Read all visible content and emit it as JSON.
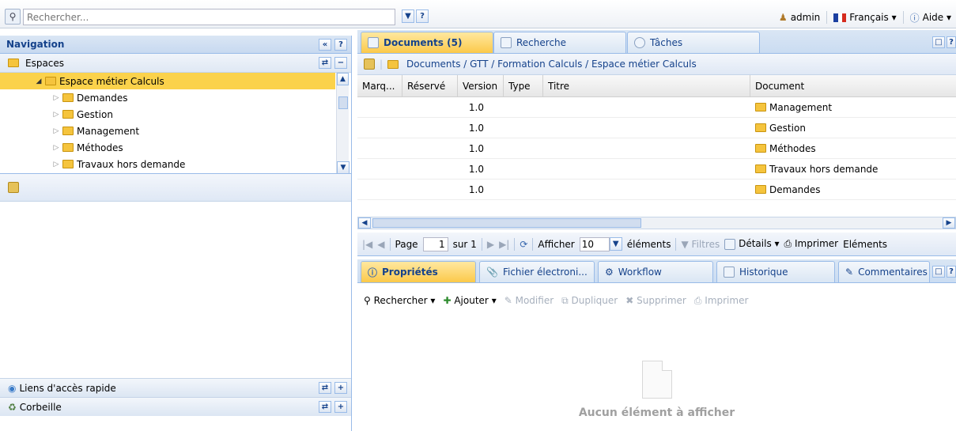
{
  "topbar": {
    "search_placeholder": "Rechercher...",
    "user": "admin",
    "language": "Français ▾",
    "help": "Aide ▾"
  },
  "navigation": {
    "title": "Navigation",
    "spaces_label": "Espaces",
    "tree": [
      {
        "label": "Espace métier Calculs",
        "selected": true,
        "level": 0
      },
      {
        "label": "Demandes",
        "level": 1
      },
      {
        "label": "Gestion",
        "level": 1
      },
      {
        "label": "Management",
        "level": 1
      },
      {
        "label": "Méthodes",
        "level": 1
      },
      {
        "label": "Travaux hors demande",
        "level": 1
      }
    ],
    "quick_links": "Liens d'accès rapide",
    "trash": "Corbeille"
  },
  "tabs": {
    "documents": "Documents (5)",
    "search": "Recherche",
    "tasks": "Tâches"
  },
  "breadcrumb": "Documents / GTT / Formation Calculs / Espace métier Calculs",
  "grid": {
    "columns": [
      "Marq...",
      "Réservé",
      "Version",
      "Type",
      "Titre",
      "Document"
    ],
    "rows": [
      {
        "version": "1.0",
        "document": "Management"
      },
      {
        "version": "1.0",
        "document": "Gestion"
      },
      {
        "version": "1.0",
        "document": "Méthodes"
      },
      {
        "version": "1.0",
        "document": "Travaux hors demande"
      },
      {
        "version": "1.0",
        "document": "Demandes"
      }
    ]
  },
  "pager": {
    "page_label": "Page",
    "page": "1",
    "of": "sur 1",
    "show_label": "Afficher",
    "page_size": "10",
    "items_label": "éléments",
    "filters": "Filtres",
    "details": "Détails ▾",
    "print": "Imprimer",
    "elements": "Eléments"
  },
  "detail_tabs": {
    "properties": "Propriétés",
    "file": "Fichier électroni...",
    "workflow": "Workflow",
    "history": "Historique",
    "comments": "Commentaires"
  },
  "actions": {
    "search": "Rechercher",
    "add": "Ajouter",
    "modify": "Modifier",
    "duplicate": "Dupliquer",
    "delete": "Supprimer",
    "print": "Imprimer"
  },
  "empty_message": "Aucun élément à afficher"
}
